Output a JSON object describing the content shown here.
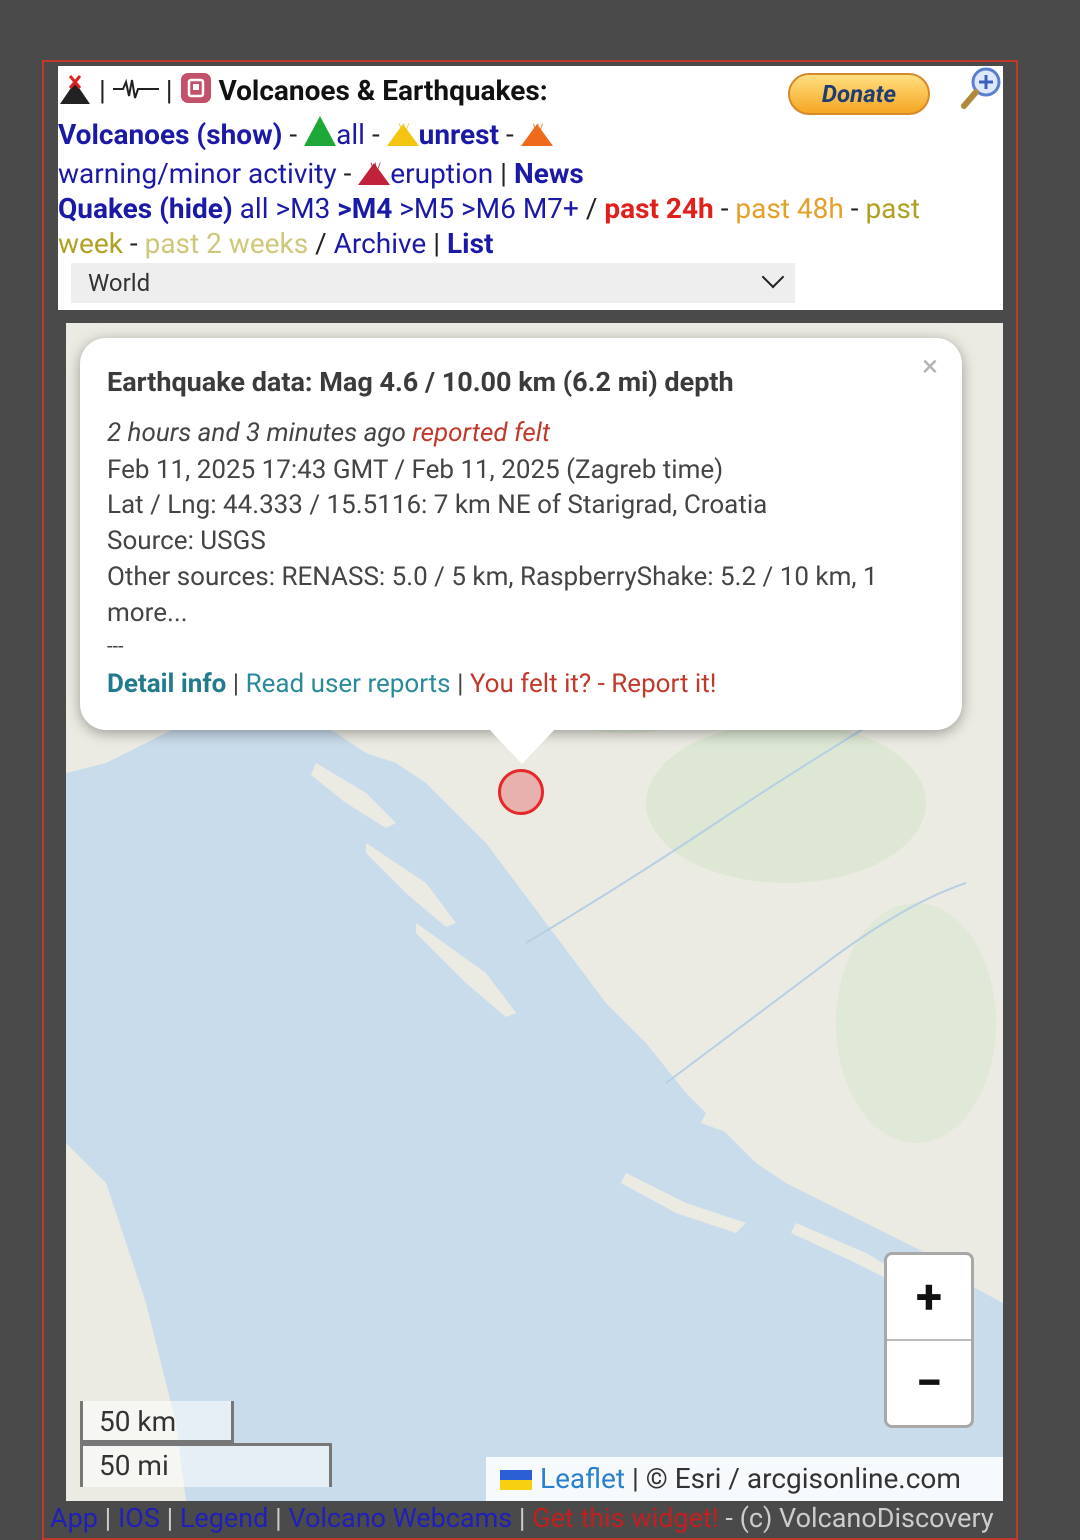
{
  "header": {
    "title": "Volcanoes & Earthquakes:",
    "donate_label": "Donate",
    "volcanoes_label": "Volcanoes (show)",
    "vol_all": "all",
    "vol_unrest": "unrest",
    "vol_warning": "warning/minor activity",
    "vol_eruption": "eruption",
    "news": "News",
    "quakes_label": "Quakes (hide)",
    "mag_all": "all",
    "mag_m3": ">M3",
    "mag_m4": ">M4",
    "mag_m5": ">M5",
    "mag_m6": ">M6",
    "mag_m7": "M7+",
    "time_24h": "past 24h",
    "time_48h": "past 48h",
    "time_week": "past week",
    "time_2weeks": "past 2 weeks",
    "archive": "Archive",
    "list": "List",
    "region_select": "World"
  },
  "popup": {
    "title": "Earthquake data: Mag 4.6 / 10.00 km (6.2 mi) depth",
    "close_symbol": "×",
    "ago": "2 hours and 3 minutes ago",
    "felt": "reported felt",
    "datetime": "Feb 11, 2025 17:43 GMT / Feb 11, 2025 (Zagreb time)",
    "location": "Lat / Lng: 44.333 / 15.5116: 7 km NE of Starigrad, Croatia",
    "source": "Source: USGS",
    "other_sources_1": "Other sources: RENASS: 5.0 / 5 km, RaspberryShake: 5.2 / 10 km, 1",
    "other_sources_2": "more...",
    "divider": "---",
    "detail_info": "Detail info",
    "read_reports": "Read user reports",
    "report_it": "You felt it? - Report it!"
  },
  "map": {
    "zoom_in": "+",
    "zoom_out": "−",
    "scale_km": "50 km",
    "scale_mi": "50 mi",
    "attribution_leaflet": "Leaflet",
    "attribution_rest": " | © Esri / arcgisonline.com",
    "marker_color": "#e12b2b"
  },
  "footer": {
    "app": "App",
    "ios": "IOS",
    "legend": "Legend",
    "webcams": "Volcano Webcams",
    "widget": "Get this widget!",
    "copyright": " - (c) VolcanoDiscovery"
  }
}
